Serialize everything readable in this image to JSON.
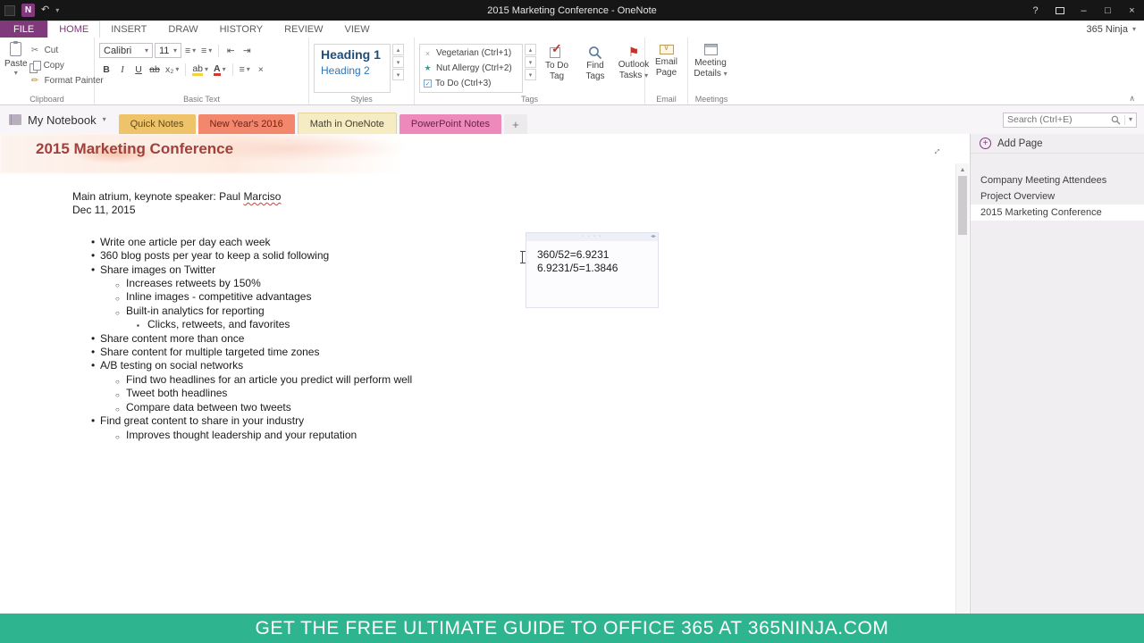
{
  "window": {
    "title": "2015 Marketing Conference - OneNote",
    "account": "365 Ninja"
  },
  "icons": {
    "onenote_logo": "N",
    "undo": "↶",
    "dropdown": "▾",
    "help": "?",
    "minimize": "–",
    "maximize": "□",
    "close": "×",
    "cut": "✂",
    "copy": "copy",
    "format_painter": "✏",
    "bold": "B",
    "italic": "I",
    "underline": "U",
    "strikethrough": "ab",
    "subscript": "x₂",
    "highlight": "ab",
    "font_color": "A",
    "align": "≡",
    "bullets": "≡",
    "numbering": "≡",
    "outdent": "⇤",
    "indent": "⇥",
    "clear_format": "×",
    "scroll_up": "▴",
    "scroll_down": "▾",
    "scroll_up_big": "▲",
    "flag": "⚑",
    "star": "★",
    "tag_x": "×",
    "check": "✓",
    "collapse_ribbon": "∧",
    "plus": "+",
    "expand_page": "↔",
    "container_dots": "· · · ·",
    "container_arrows": "◂▸"
  },
  "ribbon": {
    "tabs": [
      "FILE",
      "HOME",
      "INSERT",
      "DRAW",
      "HISTORY",
      "REVIEW",
      "VIEW"
    ],
    "active_tab": "HOME",
    "groups": {
      "clipboard": {
        "label": "Clipboard",
        "paste": "Paste",
        "cut": "Cut",
        "copy": "Copy",
        "format_painter": "Format Painter"
      },
      "basic_text": {
        "label": "Basic Text",
        "font": "Calibri",
        "font_size": "11"
      },
      "styles": {
        "label": "Styles",
        "style1": "Heading 1",
        "style2": "Heading 2"
      },
      "tags": {
        "label": "Tags",
        "tag1": "Vegetarian (Ctrl+1)",
        "tag2": "Nut Allergy (Ctrl+2)",
        "tag3": "To Do (Ctrl+3)",
        "todo_tag_l1": "To Do",
        "todo_tag_l2": "Tag",
        "find_l1": "Find",
        "find_l2": "Tags",
        "outlook_l1": "Outlook",
        "outlook_l2": "Tasks"
      },
      "email": {
        "label": "Email",
        "btn_l1": "Email",
        "btn_l2": "Page"
      },
      "meetings": {
        "label": "Meetings",
        "btn_l1": "Meeting",
        "btn_l2": "Details"
      }
    }
  },
  "section_bar": {
    "notebook": "My Notebook",
    "sections": [
      {
        "label": "Quick Notes",
        "color": "#eec36a",
        "active": false
      },
      {
        "label": "New Year's 2016",
        "color": "#f2876d",
        "active": false
      },
      {
        "label": "Math in OneNote",
        "color": "#f6ecc4",
        "active": true
      },
      {
        "label": "PowerPoint Notes",
        "color": "#ee8abb",
        "active": false
      }
    ],
    "new_section": "+",
    "search_placeholder": "Search (Ctrl+E)"
  },
  "page": {
    "title": "2015 Marketing Conference",
    "intro": [
      {
        "text_before": "Main atrium, keynote speaker: Paul ",
        "misspelled": "Marciso"
      },
      {
        "text": "Dec 11, 2015"
      }
    ],
    "bullets": [
      {
        "level": 1,
        "text": "Write one article per day each week"
      },
      {
        "level": 1,
        "text": "360 blog posts per year to keep a solid following"
      },
      {
        "level": 1,
        "text": "Share images on Twitter"
      },
      {
        "level": 2,
        "text": "Increases retweets by 150%"
      },
      {
        "level": 2,
        "text": "Inline images - competitive advantages"
      },
      {
        "level": 2,
        "text": "Built-in analytics for reporting"
      },
      {
        "level": 3,
        "text": "Clicks, retweets, and favorites"
      },
      {
        "level": 1,
        "text": "Share content more than once"
      },
      {
        "level": 1,
        "text": "Share content for multiple targeted time zones"
      },
      {
        "level": 1,
        "text": "A/B testing on social networks"
      },
      {
        "level": 2,
        "text": "Find two headlines for an article you predict will perform well"
      },
      {
        "level": 2,
        "text": "Tweet both headlines"
      },
      {
        "level": 2,
        "text": "Compare data between two tweets"
      },
      {
        "level": 1,
        "text": "Find great content to share in your industry"
      },
      {
        "level": 2,
        "text": "Improves thought leadership and your reputation"
      }
    ],
    "math_note": {
      "line1": "360/52=6.9231",
      "line2": "6.9231/5=1.3846"
    }
  },
  "page_panel": {
    "add_page": "Add Page",
    "pages": [
      {
        "title": "Company Meeting Attendees",
        "selected": false
      },
      {
        "title": "Project Overview",
        "selected": false
      },
      {
        "title": "2015 Marketing Conference",
        "selected": true
      }
    ]
  },
  "banner": {
    "text": "GET THE FREE ULTIMATE GUIDE TO OFFICE 365 AT 365NINJA.COM",
    "color": "#2eb48e"
  },
  "colors": {
    "accent_purple": "#80397b",
    "title_maroon": "#a1403c",
    "heading1_blue": "#1e4e79",
    "heading2_blue": "#2e75b5",
    "titlebar_black": "#161616"
  }
}
